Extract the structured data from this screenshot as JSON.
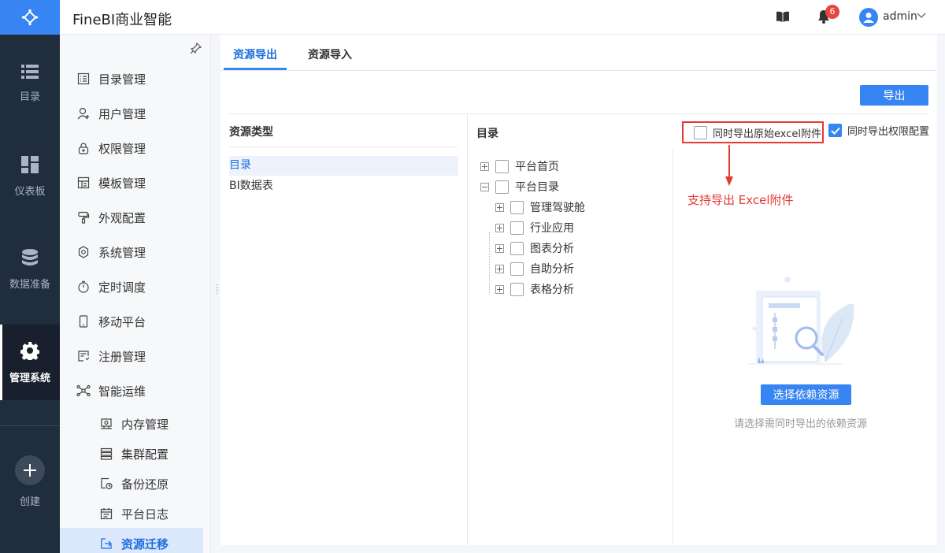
{
  "app": {
    "title": "FineBI商业智能"
  },
  "rail": {
    "items": [
      {
        "label": "目录",
        "icon": "list-icon"
      },
      {
        "label": "仪表板",
        "icon": "dashboard-icon"
      },
      {
        "label": "数据准备",
        "icon": "database-icon"
      },
      {
        "label": "管理系统",
        "icon": "gear-icon",
        "active": true
      }
    ],
    "create_label": "创建"
  },
  "topbar": {
    "notification_count": "6",
    "user": "admin"
  },
  "sidebar": {
    "items": [
      {
        "label": "目录管理",
        "icon": "catalog-icon"
      },
      {
        "label": "用户管理",
        "icon": "user-icon"
      },
      {
        "label": "权限管理",
        "icon": "lock-icon"
      },
      {
        "label": "模板管理",
        "icon": "template-icon"
      },
      {
        "label": "外观配置",
        "icon": "brush-icon"
      },
      {
        "label": "系统管理",
        "icon": "settings-icon"
      },
      {
        "label": "定时调度",
        "icon": "timer-icon"
      },
      {
        "label": "移动平台",
        "icon": "mobile-icon"
      },
      {
        "label": "注册管理",
        "icon": "register-icon"
      },
      {
        "label": "智能运维",
        "icon": "network-icon"
      }
    ],
    "sub_items": [
      {
        "label": "内存管理",
        "icon": "memory-icon"
      },
      {
        "label": "集群配置",
        "icon": "cluster-icon"
      },
      {
        "label": "备份还原",
        "icon": "backup-icon"
      },
      {
        "label": "平台日志",
        "icon": "log-icon"
      },
      {
        "label": "资源迁移",
        "icon": "migrate-icon",
        "active": true
      }
    ]
  },
  "tabs": [
    {
      "label": "资源导出",
      "active": true
    },
    {
      "label": "资源导入",
      "active": false
    }
  ],
  "export_button": "导出",
  "resource_panel": {
    "title": "资源类型",
    "items": [
      {
        "label": "目录",
        "active": true
      },
      {
        "label": "BI数据表",
        "active": false
      }
    ]
  },
  "directory_panel": {
    "title": "目录",
    "tree": [
      {
        "label": "平台首页",
        "expanded": false,
        "level": 0
      },
      {
        "label": "平台目录",
        "expanded": true,
        "level": 0
      },
      {
        "label": "管理驾驶舱",
        "expanded": false,
        "level": 1
      },
      {
        "label": "行业应用",
        "expanded": false,
        "level": 1
      },
      {
        "label": "图表分析",
        "expanded": false,
        "level": 1
      },
      {
        "label": "自助分析",
        "expanded": false,
        "level": 1
      },
      {
        "label": "表格分析",
        "expanded": false,
        "level": 1
      }
    ]
  },
  "options": {
    "export_excel": {
      "label": "同时导出原始excel附件",
      "checked": false
    },
    "export_permission": {
      "label": "同时导出权限配置",
      "checked": true
    }
  },
  "annotation": "支持导出 Excel附件",
  "dependency": {
    "button": "选择依赖资源",
    "hint": "请选择需同时导出的依赖资源"
  },
  "colors": {
    "primary": "#3685f2",
    "rail": "#1f2d3d",
    "annotation": "#e53935"
  }
}
